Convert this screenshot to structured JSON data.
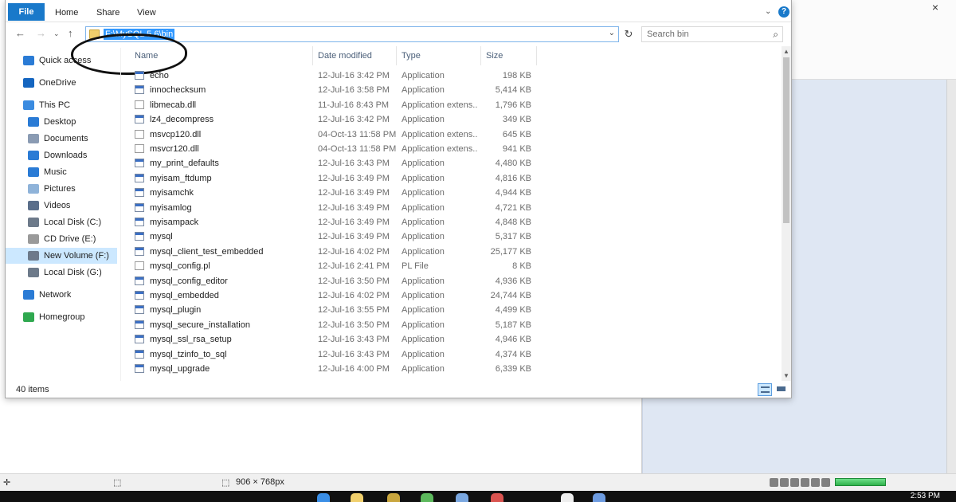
{
  "ribbon": {
    "file": "File",
    "tabs": [
      "Home",
      "Share",
      "View"
    ]
  },
  "address": {
    "path": "F:\\MySQL 5.6\\bin",
    "search_placeholder": "Search bin"
  },
  "nav": {
    "items": [
      {
        "label": "Quick access",
        "icon": "star-icon",
        "color": "#2a7bd5"
      },
      {
        "label": "OneDrive",
        "icon": "cloud-icon",
        "color": "#1465c0"
      },
      {
        "label": "This PC",
        "icon": "computer-icon",
        "color": "#3a8be0"
      },
      {
        "label": "Desktop",
        "icon": "desktop-icon",
        "color": "#2a7bd5"
      },
      {
        "label": "Documents",
        "icon": "documents-icon",
        "color": "#8a9bb3"
      },
      {
        "label": "Downloads",
        "icon": "download-icon",
        "color": "#2a7bd5"
      },
      {
        "label": "Music",
        "icon": "music-icon",
        "color": "#2a7bd5"
      },
      {
        "label": "Pictures",
        "icon": "pictures-icon",
        "color": "#8fb3d9"
      },
      {
        "label": "Videos",
        "icon": "videos-icon",
        "color": "#5a6e8a"
      },
      {
        "label": "Local Disk (C:)",
        "icon": "drive-icon",
        "color": "#6d7a8a"
      },
      {
        "label": "CD Drive (E:)",
        "icon": "cd-icon",
        "color": "#9a9a9a"
      },
      {
        "label": "New Volume (F:)",
        "icon": "drive-icon",
        "color": "#6d7a8a"
      },
      {
        "label": "Local Disk (G:)",
        "icon": "drive-icon",
        "color": "#6d7a8a"
      },
      {
        "label": "Network",
        "icon": "network-icon",
        "color": "#2a7bd5"
      },
      {
        "label": "Homegroup",
        "icon": "homegroup-icon",
        "color": "#2fa84f"
      }
    ],
    "selected_index": 11
  },
  "columns": {
    "name": "Name",
    "date": "Date modified",
    "type": "Type",
    "size": "Size"
  },
  "files": [
    {
      "name": "echo",
      "date": "12-Jul-16 3:42 PM",
      "type": "Application",
      "size": "198 KB"
    },
    {
      "name": "innochecksum",
      "date": "12-Jul-16 3:58 PM",
      "type": "Application",
      "size": "5,414 KB"
    },
    {
      "name": "libmecab.dll",
      "date": "11-Jul-16 8:43 PM",
      "type": "Application extens...",
      "size": "1,796 KB"
    },
    {
      "name": "lz4_decompress",
      "date": "12-Jul-16 3:42 PM",
      "type": "Application",
      "size": "349 KB"
    },
    {
      "name": "msvcp120.dll",
      "date": "04-Oct-13 11:58 PM",
      "type": "Application extens...",
      "size": "645 KB"
    },
    {
      "name": "msvcr120.dll",
      "date": "04-Oct-13 11:58 PM",
      "type": "Application extens...",
      "size": "941 KB"
    },
    {
      "name": "my_print_defaults",
      "date": "12-Jul-16 3:43 PM",
      "type": "Application",
      "size": "4,480 KB"
    },
    {
      "name": "myisam_ftdump",
      "date": "12-Jul-16 3:49 PM",
      "type": "Application",
      "size": "4,816 KB"
    },
    {
      "name": "myisamchk",
      "date": "12-Jul-16 3:49 PM",
      "type": "Application",
      "size": "4,944 KB"
    },
    {
      "name": "myisamlog",
      "date": "12-Jul-16 3:49 PM",
      "type": "Application",
      "size": "4,721 KB"
    },
    {
      "name": "myisampack",
      "date": "12-Jul-16 3:49 PM",
      "type": "Application",
      "size": "4,848 KB"
    },
    {
      "name": "mysql",
      "date": "12-Jul-16 3:49 PM",
      "type": "Application",
      "size": "5,317 KB"
    },
    {
      "name": "mysql_client_test_embedded",
      "date": "12-Jul-16 4:02 PM",
      "type": "Application",
      "size": "25,177 KB"
    },
    {
      "name": "mysql_config.pl",
      "date": "12-Jul-16 2:41 PM",
      "type": "PL File",
      "size": "8 KB"
    },
    {
      "name": "mysql_config_editor",
      "date": "12-Jul-16 3:50 PM",
      "type": "Application",
      "size": "4,936 KB"
    },
    {
      "name": "mysql_embedded",
      "date": "12-Jul-16 4:02 PM",
      "type": "Application",
      "size": "24,744 KB"
    },
    {
      "name": "mysql_plugin",
      "date": "12-Jul-16 3:55 PM",
      "type": "Application",
      "size": "4,499 KB"
    },
    {
      "name": "mysql_secure_installation",
      "date": "12-Jul-16 3:50 PM",
      "type": "Application",
      "size": "5,187 KB"
    },
    {
      "name": "mysql_ssl_rsa_setup",
      "date": "12-Jul-16 3:43 PM",
      "type": "Application",
      "size": "4,946 KB"
    },
    {
      "name": "mysql_tzinfo_to_sql",
      "date": "12-Jul-16 3:43 PM",
      "type": "Application",
      "size": "4,374 KB"
    },
    {
      "name": "mysql_upgrade",
      "date": "12-Jul-16 4:00 PM",
      "type": "Application",
      "size": "6,339 KB"
    }
  ],
  "status": {
    "item_count": "40 items"
  },
  "background_app": {
    "dimensions": "906 × 768px",
    "clock": "2:53 PM"
  },
  "colors": {
    "accent": "#1979ca",
    "selection": "#cce8ff",
    "address_highlight": "#3399ff"
  }
}
